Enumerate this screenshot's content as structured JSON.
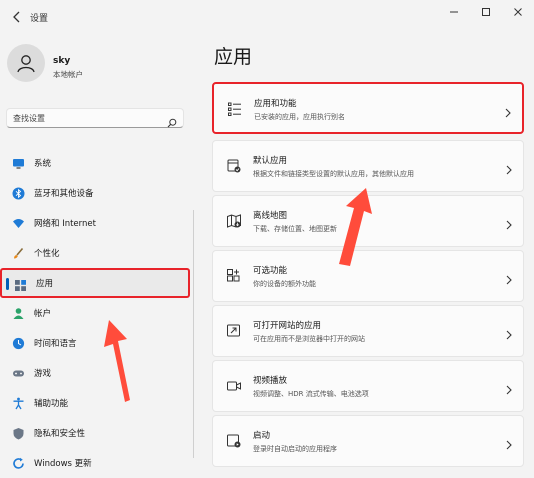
{
  "app": {
    "title": "设置"
  },
  "user": {
    "name": "sky",
    "account_type": "本地帐户"
  },
  "search": {
    "placeholder": "查找设置"
  },
  "sidebar": {
    "items": [
      {
        "label": "系统",
        "icon": "monitor-icon"
      },
      {
        "label": "蓝牙和其他设备",
        "icon": "bluetooth-icon"
      },
      {
        "label": "网络和 Internet",
        "icon": "wifi-icon"
      },
      {
        "label": "个性化",
        "icon": "brush-icon"
      },
      {
        "label": "应用",
        "icon": "apps-icon",
        "active": true
      },
      {
        "label": "帐户",
        "icon": "person-icon"
      },
      {
        "label": "时间和语言",
        "icon": "globe-clock-icon"
      },
      {
        "label": "游戏",
        "icon": "gamepad-icon"
      },
      {
        "label": "辅助功能",
        "icon": "accessibility-icon"
      },
      {
        "label": "隐私和安全性",
        "icon": "shield-icon"
      },
      {
        "label": "Windows 更新",
        "icon": "update-icon"
      }
    ]
  },
  "main": {
    "title": "应用",
    "cards": [
      {
        "title": "应用和功能",
        "desc": "已安装的应用，应用执行别名",
        "icon": "apps-list-icon",
        "highlighted": true
      },
      {
        "title": "默认应用",
        "desc": "根据文件和链接类型设置的默认应用，其他默认应用",
        "icon": "default-apps-icon"
      },
      {
        "title": "离线地图",
        "desc": "下载、存储位置、地图更新",
        "icon": "map-icon"
      },
      {
        "title": "可选功能",
        "desc": "你的设备的额外功能",
        "icon": "optional-features-icon"
      },
      {
        "title": "可打开网站的应用",
        "desc": "可在应用而不是浏览器中打开的网站",
        "icon": "open-web-icon"
      },
      {
        "title": "视频播放",
        "desc": "视频调整、HDR 流式传输、电池选项",
        "icon": "video-icon"
      },
      {
        "title": "启动",
        "desc": "登录时自动启动的应用程序",
        "icon": "startup-icon"
      }
    ]
  },
  "colors": {
    "highlight": "#e8232a",
    "accent": "#005fb8",
    "arrow": "#ff4c3b"
  }
}
